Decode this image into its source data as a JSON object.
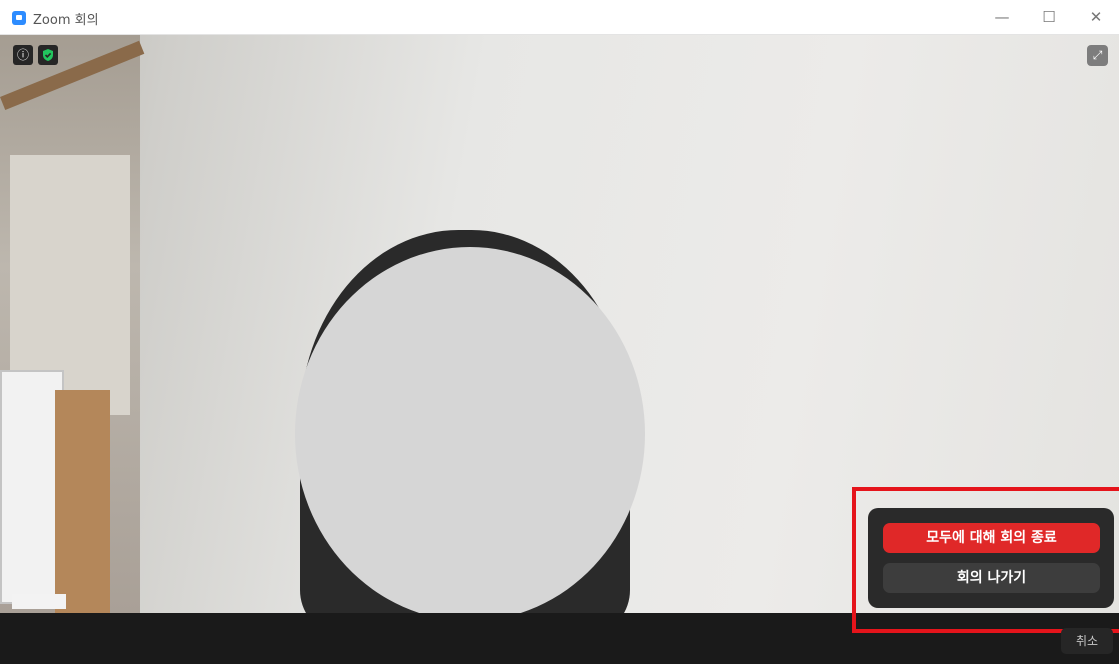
{
  "window": {
    "title": "Zoom 회의",
    "controls": {
      "minimize": "—",
      "maximize": "☐",
      "close": "✕"
    }
  },
  "meeting": {
    "info_icon": "ⓘ",
    "security_icon": "shield-check-icon",
    "fullscreen_icon": "⤢"
  },
  "end_meeting_popup": {
    "end_for_all_label": "모두에 대해 회의 종료",
    "leave_label": "회의 나가기",
    "end_for_all_color": "#e02828"
  },
  "cancel_label": "취소",
  "highlight_color": "#e5141b"
}
